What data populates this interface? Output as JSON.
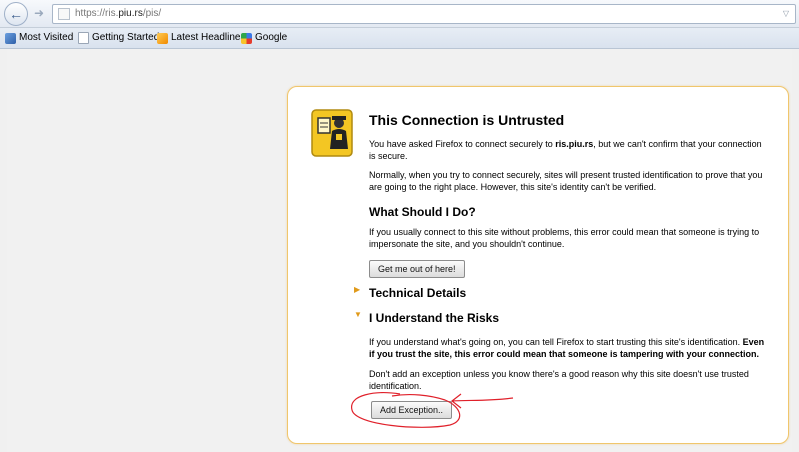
{
  "toolbar": {
    "back_icon": "back-arrow-icon",
    "forward_icon": "forward-arrow-icon",
    "url": {
      "prefix": "https://ris.",
      "domain": "piu.rs",
      "suffix": "/pis/"
    }
  },
  "bookmarks": [
    {
      "label": "Most Visited",
      "icon": "most-visited-icon"
    },
    {
      "label": "Getting Started",
      "icon": "page-icon"
    },
    {
      "label": "Latest Headlines",
      "icon": "rss-icon"
    },
    {
      "label": "Google",
      "icon": "google-icon"
    }
  ],
  "error": {
    "title": "This Connection is Untrusted",
    "p1_before": "You have asked Firefox to connect securely to ",
    "p1_host": "ris.piu.rs",
    "p1_after": ", but we can't confirm that your connection is secure.",
    "p2": "Normally, when you try to connect securely, sites will present trusted identification to prove that you are going to the right place. However, this site's identity can't be verified.",
    "what_heading": "What Should I Do?",
    "p3": "If you usually connect to this site without problems, this error could mean that someone is trying to impersonate the site, and you shouldn't continue.",
    "get_out_button": "Get me out of here!",
    "technical_details": "Technical Details",
    "understand_risks": "I Understand the Risks",
    "p4_normal": "If you understand what's going on, you can tell Firefox to start trusting this site's identification. ",
    "p4_bold": "Even if you trust the site, this error could mean that someone is tampering with your connection.",
    "p5": "Don't add an exception unless you know there's a good reason why this site doesn't use trusted identification.",
    "add_exception_button": "Add Exception.."
  },
  "colors": {
    "box_border": "#f0c66c",
    "annotation": "#e0202a",
    "expander": "#e09a1a"
  }
}
